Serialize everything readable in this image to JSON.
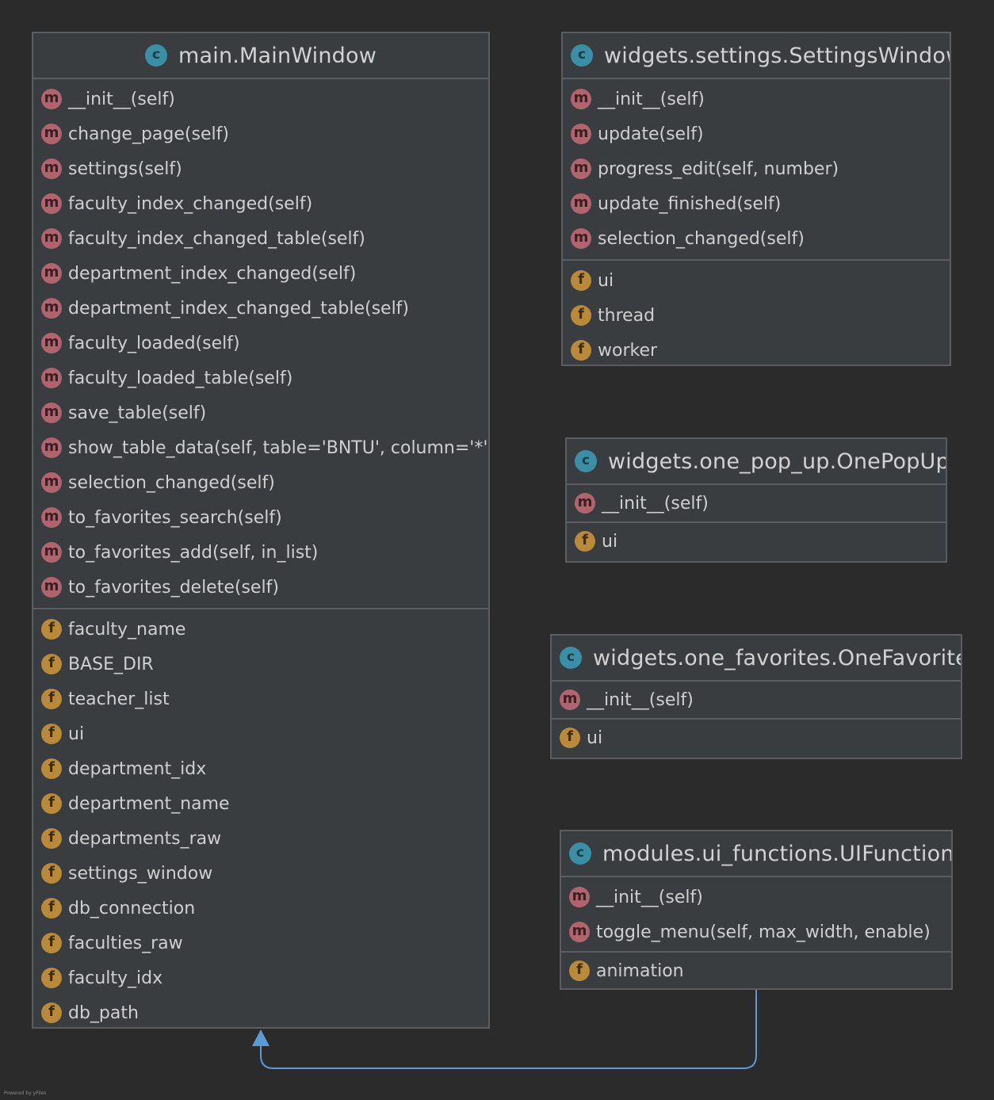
{
  "classes": [
    {
      "title": "main.MainWindow",
      "methods": [
        "__init__(self)",
        "change_page(self)",
        "settings(self)",
        "faculty_index_changed(self)",
        "faculty_index_changed_table(self)",
        "department_index_changed(self)",
        "department_index_changed_table(self)",
        "faculty_loaded(self)",
        "faculty_loaded_table(self)",
        "save_table(self)",
        "show_table_data(self, table='BNTU', column='*')",
        "selection_changed(self)",
        "to_favorites_search(self)",
        "to_favorites_add(self, in_list)",
        "to_favorites_delete(self)"
      ],
      "fields": [
        "faculty_name",
        "BASE_DIR",
        "teacher_list",
        "ui",
        "department_idx",
        "department_name",
        "departments_raw",
        "settings_window",
        "db_connection",
        "faculties_raw",
        "faculty_idx",
        "db_path"
      ]
    },
    {
      "title": "widgets.settings.SettingsWindow",
      "methods": [
        "__init__(self)",
        "update(self)",
        "progress_edit(self, number)",
        "update_finished(self)",
        "selection_changed(self)"
      ],
      "fields": [
        "ui",
        "thread",
        "worker"
      ]
    },
    {
      "title": "widgets.one_pop_up.OnePopUp",
      "methods": [
        "__init__(self)"
      ],
      "fields": [
        "ui"
      ]
    },
    {
      "title": "widgets.one_favorites.OneFavorites",
      "methods": [
        "__init__(self)"
      ],
      "fields": [
        "ui"
      ]
    },
    {
      "title": "modules.ui_functions.UIFunctions",
      "methods": [
        "__init__(self)",
        "toggle_menu(self, max_width, enable)"
      ],
      "fields": [
        "animation"
      ]
    }
  ],
  "icons": {
    "class": "c",
    "method": "m",
    "field": "f"
  },
  "colors": {
    "background": "#2b2b2b",
    "box": "#3a3d40",
    "border": "#5b5d60",
    "class_icon": "#3a8fa6",
    "method_icon": "#b0646e",
    "field_icon": "#b98a3a",
    "edge": "#5b9bd5"
  },
  "credit": "Powered by yFiles"
}
